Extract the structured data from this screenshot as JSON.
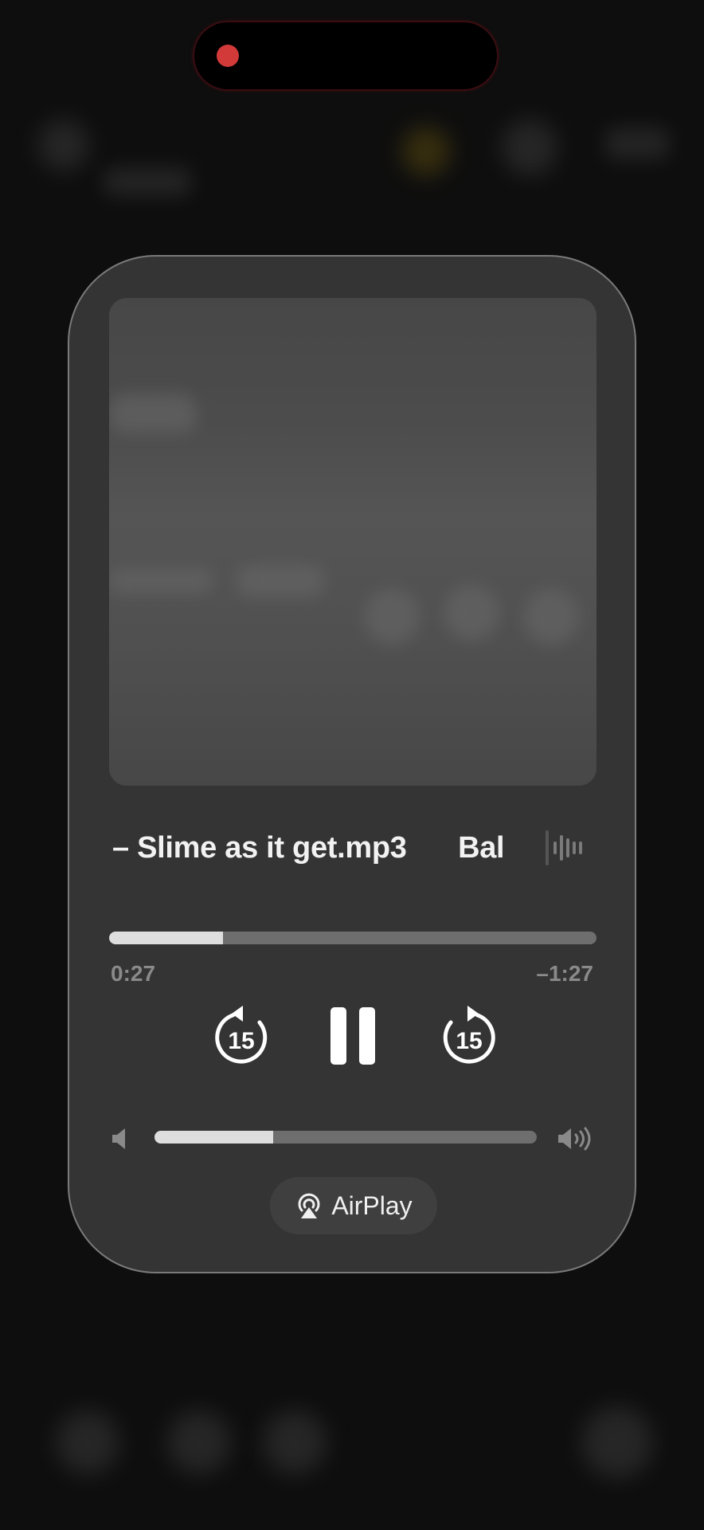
{
  "now_playing": {
    "title_marquee": "– Slime as it get.mp3",
    "title_next": "Bal",
    "elapsed": "0:27",
    "remaining": "–1:27",
    "progress_fraction": 0.234,
    "volume_fraction": 0.31
  },
  "controls": {
    "skip_back_seconds": "15",
    "skip_forward_seconds": "15"
  },
  "airplay": {
    "label": "AirPlay"
  },
  "icons": {
    "recording": "recording-dot-icon",
    "waveform": "waveform-icon",
    "skip_back": "gobackward-15-icon",
    "pause": "pause-icon",
    "skip_forward": "goforward-15-icon",
    "volume_low": "speaker-icon",
    "volume_high": "speaker-wave-3-icon",
    "airplay": "airplay-audio-icon"
  },
  "colors": {
    "recording_dot": "#d23a3a",
    "card_background": "#343434",
    "progress_fill": "#dedede",
    "progress_track": "#6e6e6e"
  }
}
